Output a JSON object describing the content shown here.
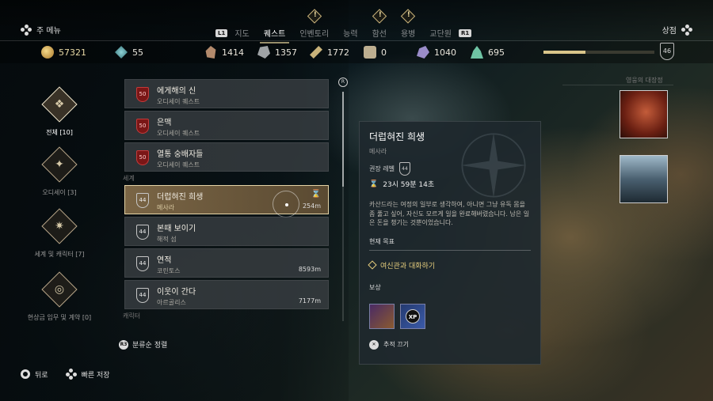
{
  "nav": {
    "main_menu": "주 메뉴",
    "store": "상점",
    "l1": "L1",
    "r1": "R1",
    "tabs": [
      {
        "label": "지도",
        "badge": false,
        "active": false
      },
      {
        "label": "퀘스트",
        "badge": false,
        "active": true
      },
      {
        "label": "인벤토리",
        "badge": true,
        "active": false
      },
      {
        "label": "능력",
        "badge": false,
        "active": false
      },
      {
        "label": "함선",
        "badge": true,
        "active": false
      },
      {
        "label": "용병",
        "badge": true,
        "active": false
      },
      {
        "label": "교단원",
        "badge": false,
        "active": false
      }
    ]
  },
  "resources": {
    "drachmae": "57321",
    "crystal": "55",
    "leather": "1414",
    "iron": "1357",
    "wood": "1772",
    "tablets": "0",
    "obsidian": "1040",
    "olive": "695",
    "player_level": "46",
    "xp_progress": 0.38
  },
  "categories": [
    {
      "label": "전체 [10]",
      "icon": "all-quests-icon",
      "active": true
    },
    {
      "label": "오디세이 [3]",
      "icon": "odyssey-icon",
      "active": false
    },
    {
      "label": "세계 및 캐릭터 [7]",
      "icon": "world-character-icon",
      "active": false
    },
    {
      "label": "현상금 임무 및 계약 [0]",
      "icon": "bounty-contract-icon",
      "active": false
    }
  ],
  "odyssey_quests": [
    {
      "name": "에게해의 신",
      "sub": "오디세이 퀘스트",
      "level": "50"
    },
    {
      "name": "은맥",
      "sub": "오디세이 퀘스트",
      "level": "50"
    },
    {
      "name": "열통 숭배자들",
      "sub": "오디세이 퀘스트",
      "level": "50"
    }
  ],
  "world_label": "세계",
  "world_quests": [
    {
      "name": "더럽혀진 희생",
      "sub": "메사라",
      "level": "44",
      "dist": "254m",
      "selected": true
    },
    {
      "name": "본때 보이기",
      "sub": "해적 섬",
      "level": "44",
      "dist": "",
      "selected": false
    },
    {
      "name": "연적",
      "sub": "코린토스",
      "level": "44",
      "dist": "8593m",
      "selected": false
    },
    {
      "name": "이웃이 간다",
      "sub": "아르골리스",
      "level": "44",
      "dist": "7177m",
      "selected": false
    }
  ],
  "character_label": "캐릭터",
  "scroll_badge": "R",
  "sort": {
    "button": "R3",
    "label": "분류순 정렬"
  },
  "detail": {
    "title": "더럽혀진 희생",
    "location": "메사라",
    "level_label": "권장 레벨",
    "level": "44",
    "time": "23시 59분 14초",
    "description": "카산드라는 여정의 일부로 생각하여, 아니면 그냥 유독 몸을 좀 풀고 싶어, 자신도 모르게 일을 완료해버렸습니다. 남은 일은 돈을 챙기는 것뿐이었습니다.",
    "objective_head": "현재 목표",
    "objective": "여신관과 대화하기",
    "reward_head": "보상",
    "xp": "XP",
    "track": "추적 끄기"
  },
  "mercenary_label": "영웅의 대장정",
  "bottom": {
    "back": "뒤로",
    "quick_save": "빠른 저장"
  }
}
